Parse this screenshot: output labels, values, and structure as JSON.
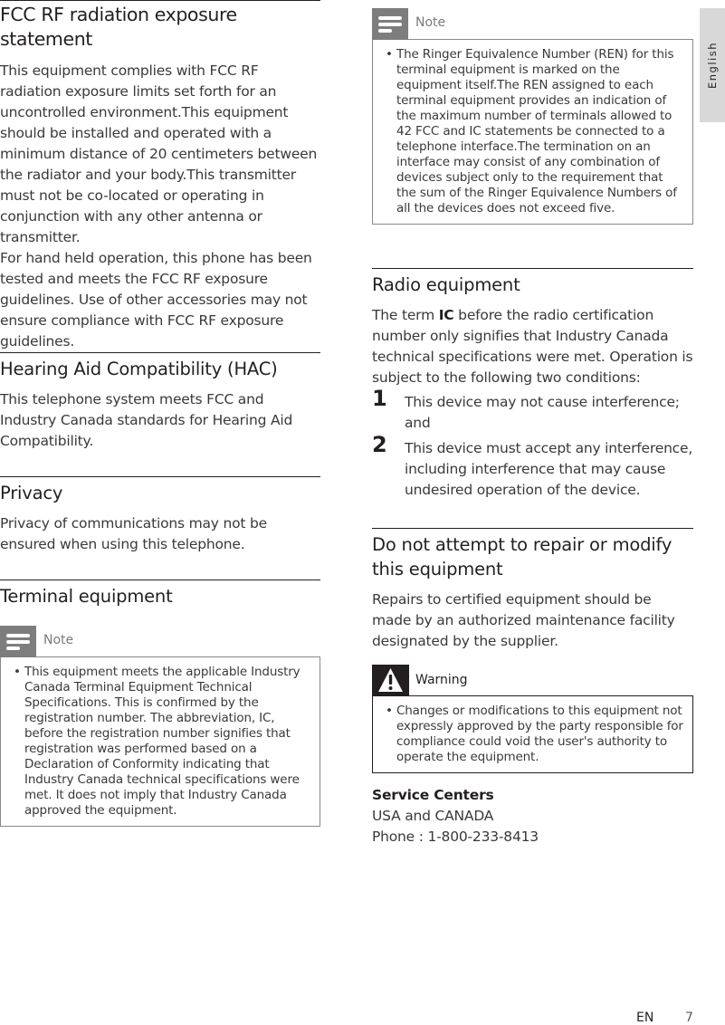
{
  "left_column": {
    "fcc": {
      "title": "FCC RF radiation exposure statement",
      "paragraph1": "This equipment complies with FCC RF radiation exposure limits set forth for an uncontrolled environment.This equipment should be installed and operated with a minimum distance of 20 centimeters between the radiator and your body.This transmitter must not be co-located or operating in conjunction with any other antenna or transmitter.",
      "paragraph2": "For hand held operation, this phone has been tested and meets the FCC RF exposure guidelines. Use of other accessories may not ensure compliance with FCC RF exposure guidelines."
    },
    "hac": {
      "title": "Hearing Aid Compatibility (HAC)",
      "paragraph": "This telephone system meets FCC and Industry Canada standards for Hearing Aid Compatibility."
    },
    "privacy": {
      "title": "Privacy",
      "paragraph": "Privacy of communications may not be ensured when using this telephone."
    },
    "terminal": {
      "title": "Terminal equipment",
      "note_label": "Note",
      "note_bullet": "This equipment meets the applicable Industry Canada Terminal Equipment Technical Specifications. This is confirmed by the registration number. The abbreviation, IC, before the registration number signifies that registration was performed based on a Declaration of Conformity indicating that Industry Canada technical specifications were met. It does not imply that Industry Canada approved the equipment."
    }
  },
  "right_column": {
    "ren_note": {
      "label": "Note",
      "bullet": "The Ringer Equivalence Number (REN) for this terminal equipment is marked on the equipment itself.The REN assigned to each terminal equipment provides an indication of the maximum number of terminals allowed to 42 FCC and IC statements be connected to a telephone interface.The termination on an interface may consist of any combination of devices subject only to the requirement that the sum of the Ringer Equivalence Numbers of all the devices does not exceed five."
    },
    "radio": {
      "title": "Radio equipment",
      "intro_before": "The term ",
      "intro_bold": "IC",
      "intro_after": " before the radio certification number only signifies that Industry Canada technical specifications were met. Operation is subject to the following two conditions:",
      "conditions": [
        {
          "num": "1",
          "text": "This device may not cause interference; and"
        },
        {
          "num": "2",
          "text": "This device must accept any interference, including interference that may cause undesired operation of the device."
        }
      ]
    },
    "repair": {
      "title": "Do not attempt to repair or modify this equipment",
      "paragraph": "Repairs to certified equipment should be made by an authorized maintenance facility designated by the supplier."
    },
    "warning": {
      "label": "Warning",
      "bullet": "Changes or modifications to this equipment not expressly approved by the party responsible for compliance could void the user's authority to operate the equipment."
    },
    "service": {
      "title": "Service Centers",
      "region": "USA and CANADA",
      "phone": "Phone : 1-800-233-8413"
    }
  },
  "side_tab": {
    "label": "English"
  },
  "footer": {
    "lang": "EN",
    "page": "7"
  }
}
